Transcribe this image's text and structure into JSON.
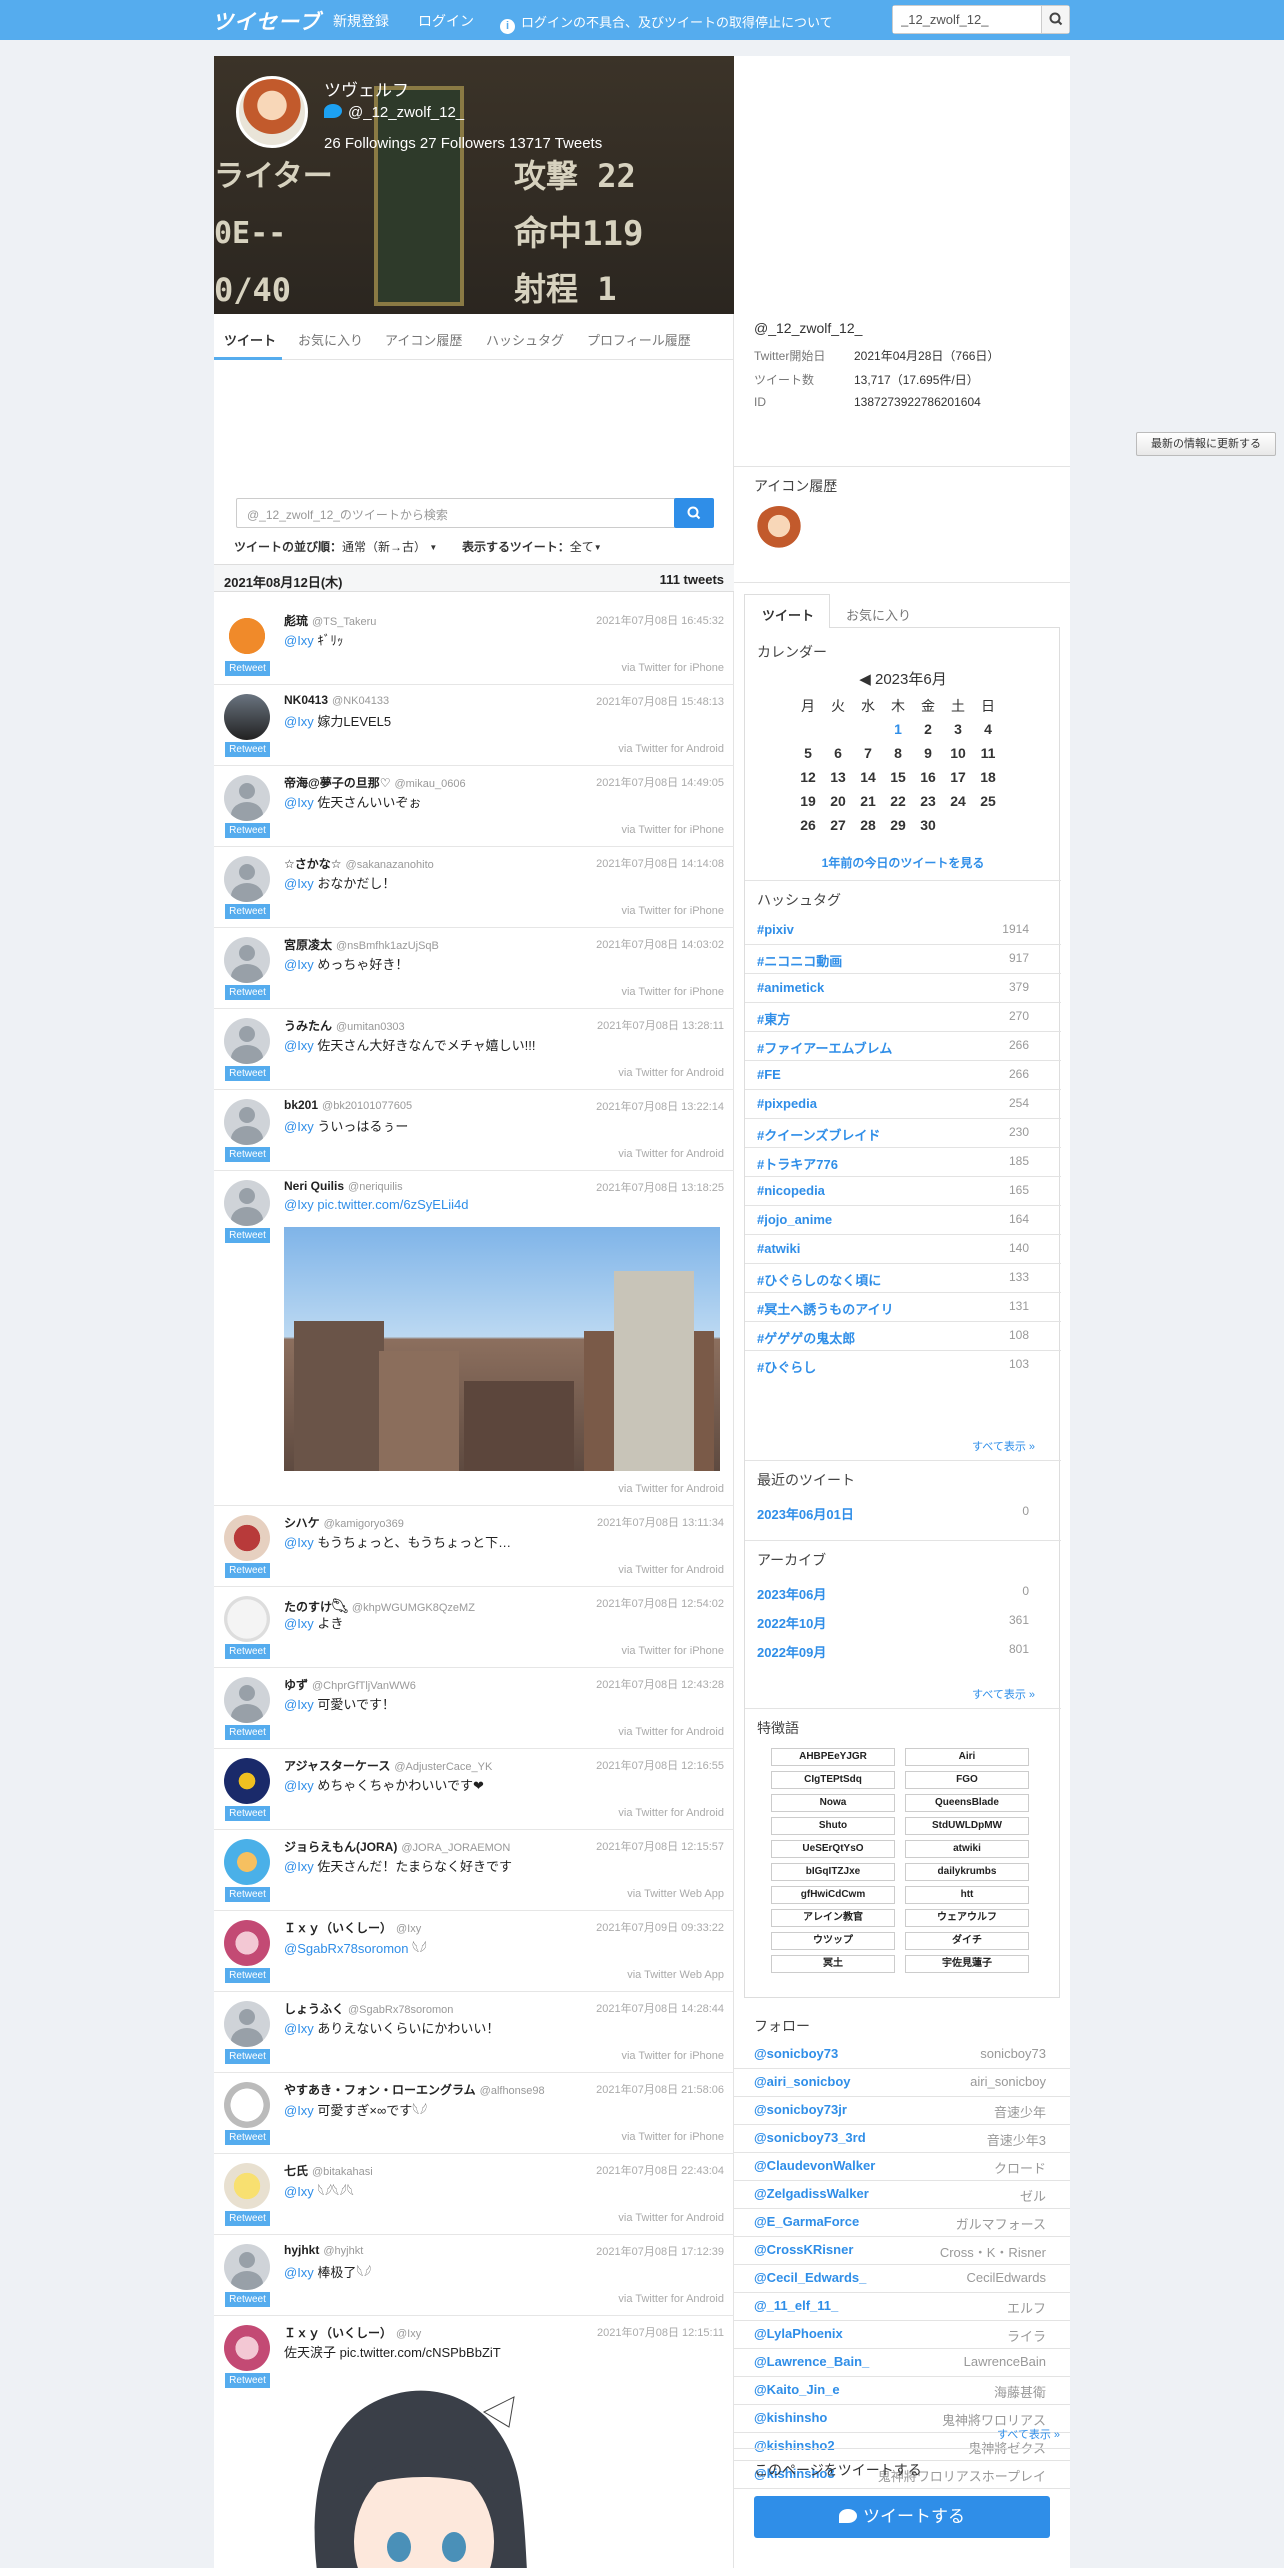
{
  "topbar": {
    "logo": "ツイセーブ",
    "nav_register": "新規登録",
    "nav_login": "ログイン",
    "nav_notice": "ログインの不具合、及びツイートの取得停止について",
    "search_value": "_12_zwolf_12_"
  },
  "profile": {
    "name": "ツヴェルフ",
    "handle": "@_12_zwolf_12_",
    "stats": "26 Followings 27 Followers  13717 Tweets",
    "header_texts": [
      "ライター",
      "0E--",
      "0/40",
      "攻撃 22",
      "命中119",
      "射程 1"
    ]
  },
  "tabs": [
    "ツイート",
    "お気に入り",
    "アイコン履歴",
    "ハッシュタグ",
    "プロフィール履歴"
  ],
  "search": {
    "placeholder": "@_12_zwolf_12_のツイートから検索"
  },
  "sort": {
    "label": "ツイートの並び順：",
    "value": "通常（新→古）",
    "filter_label": "表示するツイート：",
    "filter_value": "全て"
  },
  "day": {
    "date": "2021年08月12日(木)",
    "count": "111 tweets"
  },
  "retweet_label": "Retweet",
  "tweets": [
    {
      "name": "彪琉",
      "handle": "@TS_Takeru",
      "date": "2021年07月08日 16:45:32",
      "mention": "@Ixy",
      "text": "ｷﾞﾘｯ",
      "via": "via Twitter for iPhone"
    },
    {
      "name": "NK0413",
      "handle": "@NK04133",
      "date": "2021年07月08日 15:48:13",
      "mention": "@Ixy",
      "text": "嫁力LEVEL5",
      "via": "via Twitter for Android"
    },
    {
      "name": "帝海@夢子の旦那♡",
      "handle": "@mikau_0606",
      "date": "2021年07月08日 14:49:05",
      "mention": "@Ixy",
      "text": "佐天さんいいぞぉ",
      "via": "via Twitter for iPhone"
    },
    {
      "name": "☆さかな☆",
      "handle": "@sakanazanohito",
      "date": "2021年07月08日 14:14:08",
      "mention": "@Ixy",
      "text": "おなかだし！",
      "via": "via Twitter for iPhone"
    },
    {
      "name": "宮原凌太",
      "handle": "@nsBmfhk1azUjSqB",
      "date": "2021年07月08日 14:03:02",
      "mention": "@Ixy",
      "text": "めっちゃ好き！",
      "via": "via Twitter for iPhone"
    },
    {
      "name": "うみたん",
      "handle": "@umitan0303",
      "date": "2021年07月08日 13:28:11",
      "mention": "@Ixy",
      "text": "佐天さん大好きなんでメチャ嬉しい!!!",
      "via": "via Twitter for Android"
    },
    {
      "name": "bk201",
      "handle": "@bk20101077605",
      "date": "2021年07月08日 13:22:14",
      "mention": "@Ixy",
      "text": "ういっはるぅー",
      "via": "via Twitter for Android"
    },
    {
      "name": "Neri Quilis",
      "handle": "@neriquilis",
      "date": "2021年07月08日 13:18:25",
      "mention": "@Ixy",
      "text": "pic.twitter.com/6zSyELii4d",
      "via": "via Twitter for Android"
    },
    {
      "name": "シハケ",
      "handle": "@kamigoryo369",
      "date": "2021年07月08日 13:11:34",
      "mention": "@Ixy",
      "text": "もうちょっと、もうちょっと下…",
      "via": "via Twitter for Android"
    },
    {
      "name": "たのすけ𓆡",
      "handle": "@khpWGUMGK8QzeMZ",
      "date": "2021年07月08日 12:54:02",
      "mention": "@Ixy",
      "text": "よき",
      "via": "via Twitter for iPhone"
    },
    {
      "name": "ゆず",
      "handle": "@ChprGfTljVanWW6",
      "date": "2021年07月08日 12:43:28",
      "mention": "@Ixy",
      "text": "可愛いです！",
      "via": "via Twitter for Android"
    },
    {
      "name": "アジャスターケース",
      "handle": "@AdjusterCace_YK",
      "date": "2021年07月08日 12:16:55",
      "mention": "@Ixy",
      "text": "めちゃくちゃかわいいです❤",
      "via": "via Twitter for Android"
    },
    {
      "name": "ジョらえもん(JORA)",
      "handle": "@JORA_JORAEMON",
      "date": "2021年07月08日 12:15:57",
      "mention": "@Ixy",
      "text": "佐天さんだ！たまらなく好きです",
      "via": "via Twitter Web App"
    },
    {
      "name": "Ｉｘｙ（いくしー）",
      "handle": "@Ixy",
      "date": "2021年07月09日 09:33:22",
      "mention": "@SgabRx78soromon",
      "text": "𓆩𓆪",
      "via": "via Twitter Web App"
    },
    {
      "name": "しょうふく",
      "handle": "@SgabRx78soromon",
      "date": "2021年07月08日 14:28:44",
      "mention": "@Ixy",
      "text": "ありえないくらいにかわいい！",
      "via": "via Twitter for iPhone"
    },
    {
      "name": "やすあき・フォン・ローエングラム",
      "handle": "@alfhonse98",
      "date": "2021年07月08日 21:58:06",
      "mention": "@Ixy",
      "text": "可愛すぎ×∞です𓆩𓆪",
      "via": "via Twitter for iPhone"
    },
    {
      "name": "七氏",
      "handle": "@bitakahasi",
      "date": "2021年07月08日 22:43:04",
      "mention": "@Ixy",
      "text": "𓆩𓆪𓆩𓆪𓆩",
      "via": "via Twitter for Android"
    },
    {
      "name": "hyjhkt",
      "handle": "@hyjhkt",
      "date": "2021年07月08日 17:12:39",
      "mention": "@Ixy",
      "text": "棒极了𓆩𓆪",
      "via": "via Twitter for Android"
    },
    {
      "name": "Ｉｘｙ（いくしー）",
      "handle": "@Ixy",
      "date": "2021年07月08日 12:15:11",
      "mention": "",
      "text": "佐天涙子 pic.twitter.com/cNSPbBbZiT",
      "via": ""
    }
  ],
  "side": {
    "handle": "@_12_zwolf_12_",
    "info": [
      {
        "k": "Twitter開始日",
        "v": "2021年04月28日（766日）"
      },
      {
        "k": "ツイート数",
        "v": "13,717（17.695件/日）"
      },
      {
        "k": "ID",
        "v": "1387273922786201604"
      }
    ],
    "update_button": "最新の情報に更新する",
    "icon_history": "アイコン履歴",
    "tabs": [
      "ツイート",
      "お気に入り"
    ],
    "calendar": {
      "title": "カレンダー",
      "month": "2023年6月",
      "prev": "◀",
      "weekdays": [
        "月",
        "火",
        "水",
        "木",
        "金",
        "土",
        "日"
      ],
      "days": [
        "1",
        "2",
        "3",
        "4",
        "5",
        "6",
        "7",
        "8",
        "9",
        "10",
        "11",
        "12",
        "13",
        "14",
        "15",
        "16",
        "17",
        "18",
        "19",
        "20",
        "21",
        "22",
        "23",
        "24",
        "25",
        "26",
        "27",
        "28",
        "29",
        "30"
      ],
      "link": "1年前の今日のツイートを見る"
    },
    "hashtag_title": "ハッシュタグ",
    "hashtags": [
      [
        "#pixiv",
        "1914"
      ],
      [
        "#ニコニコ動画",
        "917"
      ],
      [
        "#animetick",
        "379"
      ],
      [
        "#東方",
        "270"
      ],
      [
        "#ファイアーエムブレム",
        "266"
      ],
      [
        "#FE",
        "266"
      ],
      [
        "#pixpedia",
        "254"
      ],
      [
        "#クイーンズブレイド",
        "230"
      ],
      [
        "#トラキア776",
        "185"
      ],
      [
        "#nicopedia",
        "165"
      ],
      [
        "#jojo_anime",
        "164"
      ],
      [
        "#atwiki",
        "140"
      ],
      [
        "#ひぐらしのなく頃に",
        "133"
      ],
      [
        "#冥土へ誘うものアイリ",
        "131"
      ],
      [
        "#ゲゲゲの鬼太郎",
        "108"
      ],
      [
        "#ひぐらし",
        "103"
      ]
    ],
    "see_all": "すべて表示 »",
    "recent_title": "最近のツイート",
    "recent": [
      [
        "2023年06月01日",
        "0"
      ]
    ],
    "archive_title": "アーカイブ",
    "archive": [
      [
        "2023年06月",
        "0"
      ],
      [
        "2022年10月",
        "361"
      ],
      [
        "2022年09月",
        "801"
      ]
    ],
    "keyword_title": "特徴語",
    "keywords": [
      "AHBPEeYJGR",
      "Airi",
      "CIgTEPtSdq",
      "FGO",
      "Nowa",
      "QueensBlade",
      "Shuto",
      "StdUWLDpMW",
      "UeSErQtYsO",
      "atwiki",
      "bIGqITZJxe",
      "dailykrumbs",
      "gfHwiCdCwm",
      "htt",
      "アレイン教官",
      "ウェアウルフ",
      "ウツップ",
      "ダイチ",
      "冥土",
      "宇佐見蓮子"
    ],
    "follow_title": "フォロー",
    "follows": [
      [
        "@sonicboy73",
        "sonicboy73"
      ],
      [
        "@airi_sonicboy",
        "airi_sonicboy"
      ],
      [
        "@sonicboy73jr",
        "音速少年"
      ],
      [
        "@sonicboy73_3rd",
        "音速少年3"
      ],
      [
        "@ClaudevonWalker",
        "クロード"
      ],
      [
        "@ZelgadissWalker",
        "ゼル"
      ],
      [
        "@E_GarmaForce",
        "ガルマフォース"
      ],
      [
        "@CrossKRisner",
        "Cross・K・Risner"
      ],
      [
        "@Cecil_Edwards_",
        "CecilEdwards"
      ],
      [
        "@_11_elf_11_",
        "エルフ"
      ],
      [
        "@LylaPhoenix",
        "ライラ"
      ],
      [
        "@Lawrence_Bain_",
        "LawrenceBain"
      ],
      [
        "@Kaito_Jin_e",
        "海藤甚衛"
      ],
      [
        "@kishinsho",
        "鬼神將ワロリアス"
      ],
      [
        "@kishinsho2",
        "鬼神將ゼクス"
      ],
      [
        "@kishinsho3",
        "鬼神將ワロリアスホープレイ"
      ]
    ],
    "share_title": "このページをツイートする",
    "tweet_button": "ツイートする"
  },
  "colors": {
    "accent": "#55acee",
    "link": "#2f8ee8"
  }
}
